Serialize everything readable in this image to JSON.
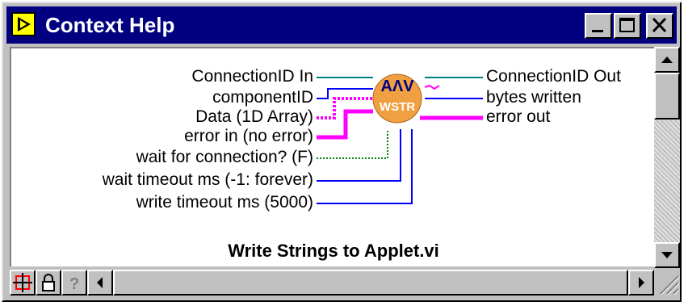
{
  "window": {
    "title": "Context Help"
  },
  "titlebar_buttons": {
    "minimize": "minimize",
    "maximize": "maximize",
    "close": "close"
  },
  "vi": {
    "icon_line1": "AΛV",
    "icon_line2": "WSTR",
    "inputs": [
      "ConnectionID In",
      "componentID",
      "Data (1D Array)",
      "error in (no error)",
      "wait for connection? (F)",
      "wait timeout ms (-1: forever)",
      "write timeout ms (5000)"
    ],
    "outputs": [
      "ConnectionID Out",
      "bytes written",
      "error out"
    ],
    "caption": "Write Strings to Applet.vi"
  },
  "colors": {
    "refnum": "#008080",
    "int": "#0000ff",
    "string": "#ff00ff",
    "bool": "#008000",
    "icon_fill": "#f0a040"
  },
  "tools": [
    "diagram-toggle-icon",
    "lock-icon",
    "help-question-icon"
  ]
}
